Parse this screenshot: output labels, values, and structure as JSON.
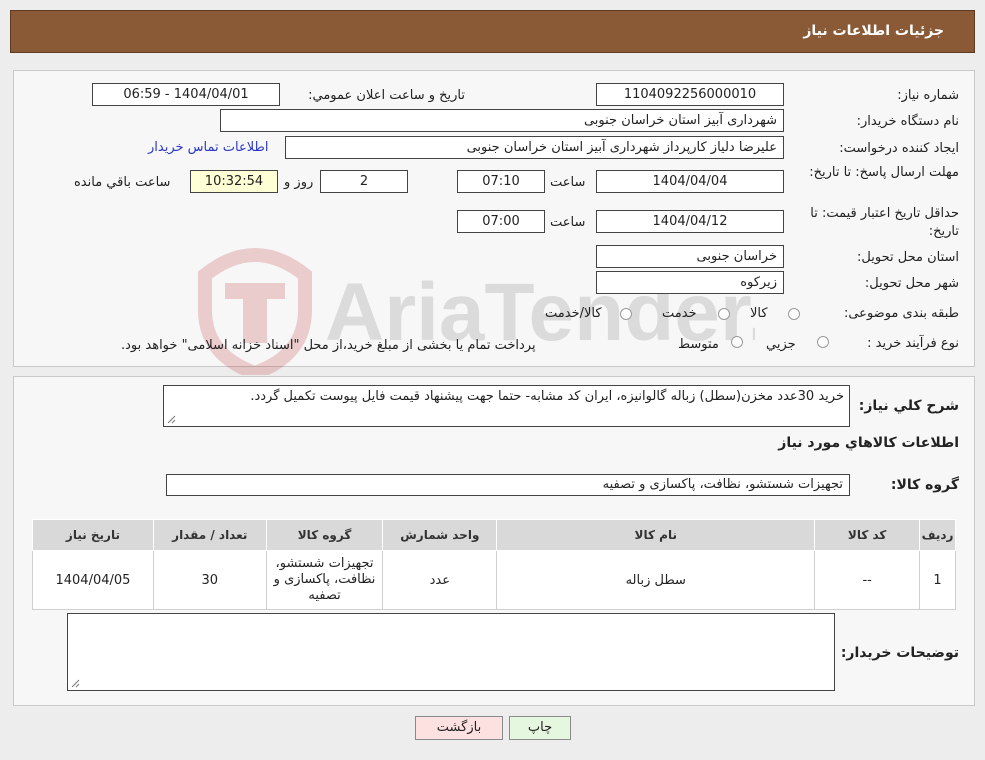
{
  "header": {
    "title": "جزئیات اطلاعات نیاز"
  },
  "fields": {
    "need_number_label": "شماره نیاز:",
    "need_number": "1104092256000010",
    "announce_label": "تاریخ و ساعت اعلان عمومي:",
    "announce_value": "1404/04/01 - 06:59",
    "buyer_org_label": "نام دستگاه خريدار:",
    "buyer_org": "شهرداری آبیز استان خراسان جنوبی",
    "requester_label": "ايجاد کننده درخواست:",
    "requester": "علیرضا دلیاز کارپرداز شهرداری آبیز استان خراسان جنوبی",
    "contact_link": "اطلاعات تماس خريدار",
    "reply_deadline_label": "مهلت ارسال پاسخ: تا تاریخ:",
    "reply_date": "1404/04/04",
    "time_label": "ساعت",
    "reply_time": "07:10",
    "days_value": "2",
    "days_label": "روز و",
    "remaining_time": "10:32:54",
    "remaining_label": "ساعت باقي مانده",
    "price_validity_label": "حداقل تاريخ اعتبار قيمت: تا تاریخ:",
    "validity_date": "1404/04/12",
    "validity_time": "07:00",
    "province_label": "استان محل تحویل:",
    "province": "خراسان جنوبی",
    "city_label": "شهر محل تحویل:",
    "city": "زیرکوه",
    "category_label": "طبقه بندی موضوعی:",
    "category_options": [
      "کالا",
      "خدمت",
      "کالا/خدمت"
    ],
    "process_label": "نوع فرآيند خريد :",
    "process_options": [
      "جزيي",
      "متوسط"
    ],
    "process_note": "پرداخت تمام یا بخشی از مبلغ خرید،از محل \"اسناد خزانه اسلامی\" خواهد بود."
  },
  "description": {
    "label": "شرح کلي نياز:",
    "text": "خرید 30عدد مخزن(سطل) زباله گالوانیزه، ایران کد مشابه- حتما جهت پیشنهاد قیمت فایل پیوست تکمیل گردد."
  },
  "goods": {
    "section_title": "اطلاعات کالاهاي مورد نياز",
    "group_label": "گروه کالا:",
    "group_value": "تجهیزات شستشو، نظافت، پاکسازی و تصفیه",
    "columns": [
      "رديف",
      "کد کالا",
      "نام کالا",
      "واحد شمارش",
      "گروه کالا",
      "تعداد / مقدار",
      "تاريخ نياز"
    ],
    "rows": [
      [
        "1",
        "--",
        "سطل زباله",
        "عدد",
        "تجهیزات شستشو، نظافت، پاکسازی و تصفیه",
        "30",
        "1404/04/05"
      ]
    ]
  },
  "buyer_notes": {
    "label": "توضيحات خريدار:",
    "text": ""
  },
  "buttons": {
    "print": "چاپ",
    "back": "بازگشت"
  },
  "watermark": {
    "text": "AriaTender.neT"
  },
  "colors": {
    "header_bg": "#8a5a36",
    "link": "#2a37c7",
    "back_button_bg": "#fde1e1",
    "print_button_bg": "#e6f7e0"
  }
}
